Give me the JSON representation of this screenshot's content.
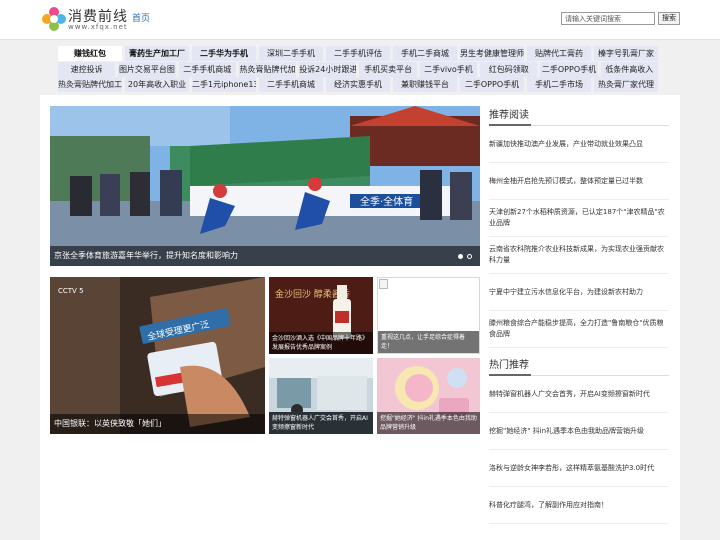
{
  "brand": {
    "name": "消费前线",
    "url": "www.xfqx.net"
  },
  "nav": {
    "home": "首页"
  },
  "search": {
    "placeholder": "请输入关键词搜索",
    "button": "搜索"
  },
  "tags": [
    [
      "赚钱红包",
      "膏药生产加工厂",
      "二手华为手机",
      "深圳二手手机",
      "二手手机评估",
      "手机二手商城",
      "男生考健康管理师",
      "贴牌代工膏药",
      "榛字号乳膏厂家"
    ],
    [
      "速控投诉",
      "图片交易平台图",
      "二手手机商城",
      "热灸膏贴牌代加",
      "投诉24小时跟进",
      "手机买卖平台",
      "二手vivo手机",
      "红包码领取",
      "二手OPPO手机",
      "低条件高收入"
    ],
    [
      "热灸膏贴牌代加工",
      "20年高收入职业",
      "二手1元iphone13",
      "二手手机商城",
      "经济实惠手机",
      "兼职赚钱平台",
      "二手OPPO手机",
      "手机二手市场",
      "热灸膏厂家代理"
    ]
  ],
  "hero": {
    "caption": "京张全季体育旅游嘉年华举行，提升知名度和影响力",
    "banner_text": "全季·全体育"
  },
  "tiles": {
    "big": {
      "caption": "中国银联：以英侠致敬「她们」",
      "card_text": "全球受理更广泛",
      "channel": "CCTV 5"
    },
    "t1": {
      "caption": "金沙回沙酒入选《中国品牌十年路》发展报告优秀品牌案例",
      "label": "金沙回沙 醇柔酱香"
    },
    "t2": {
      "caption": "重视这几点，让手足综合症得着走！"
    },
    "t3": {
      "caption": "赫特弹窗机器人广交会首秀，开启AI变频擦窗新时代"
    },
    "t4": {
      "caption": "挖掘\"她经济\" 抖in礼遇季本色由我助品牌营销升级"
    }
  },
  "recommended": {
    "title": "推荐阅读",
    "items": [
      "新疆加快推动澳产业发展，产业带动就业效果凸显",
      "梅州金柚开启抢先预订模式，整体预定量已过半数",
      "天津创新27个水稻种质资源，已认定187个\"津农精品\"农业品牌",
      "云南省农科院推介农业科技新成果，为实现农业强贡献农科力量",
      "宁夏中宁建立污水信息化平台，为建设新农村助力",
      "滕州粮食综合产能稳步提高，全力打造\"鲁南粮仓\"优质粮食品牌"
    ]
  },
  "hot": {
    "title": "热门推荐",
    "items": [
      "赫特弹窗机器人广交会首秀，开启AI变频擦窗新时代",
      "挖掘\"她经济\" 抖in礼遇季本色由我助品牌营销升级",
      "洛秋与逆龄女神李若彤，这样精萃氨基酸洗护3.0时代",
      "科普化疗腿湾，了解副作用应对指南！"
    ]
  },
  "colors": {
    "accent": "#2b6fc0",
    "tag_bg": "#e4e7f3",
    "caption_bg": "rgba(0,0,0,0.55)"
  }
}
